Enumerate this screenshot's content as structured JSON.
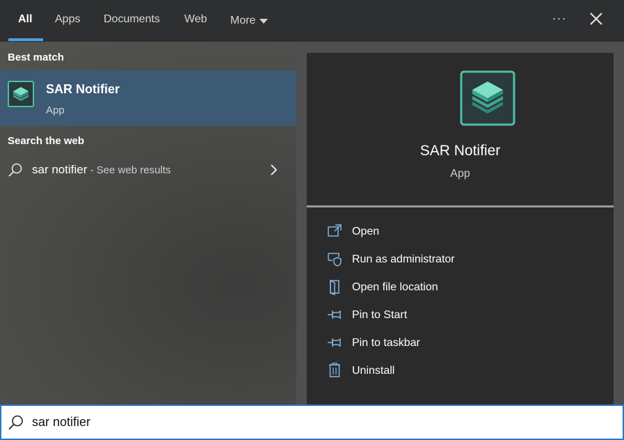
{
  "tabs": [
    {
      "label": "All",
      "active": true
    },
    {
      "label": "Apps"
    },
    {
      "label": "Documents"
    },
    {
      "label": "Web"
    },
    {
      "label": "More"
    }
  ],
  "toolbar": {
    "more_options_icon": "ellipsis-icon",
    "close_icon": "close-icon"
  },
  "best_match": {
    "section_label": "Best match",
    "app_name": "SAR Notifier",
    "app_type": "App"
  },
  "web": {
    "section_label": "Search the web",
    "query": "sar notifier",
    "suffix": " - See web results"
  },
  "detail": {
    "app_name": "SAR Notifier",
    "app_type": "App",
    "actions": [
      {
        "label": "Open",
        "icon": "open-icon"
      },
      {
        "label": "Run as administrator",
        "icon": "shield-icon"
      },
      {
        "label": "Open file location",
        "icon": "folder-icon"
      },
      {
        "label": "Pin to Start",
        "icon": "pin-icon"
      },
      {
        "label": "Pin to taskbar",
        "icon": "pin-icon"
      },
      {
        "label": "Uninstall",
        "icon": "trash-icon"
      }
    ]
  },
  "search": {
    "value": "sar notifier"
  },
  "colors": {
    "accent": "#2a78c6",
    "selected": "#3c5a73",
    "app_icon": "#4fbfa8"
  }
}
